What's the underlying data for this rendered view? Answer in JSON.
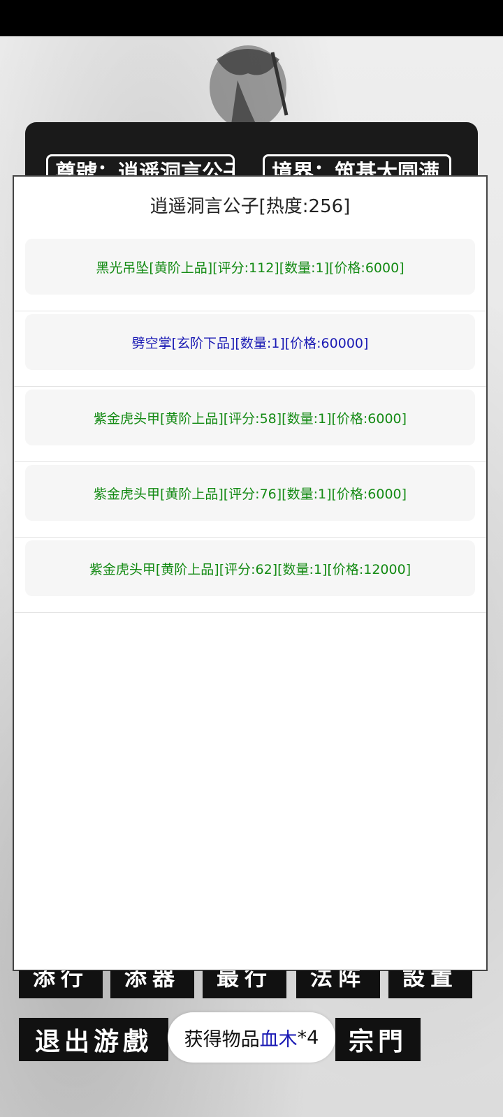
{
  "player_panel": {
    "left_box": "尊號：逍遥洞言公子",
    "right_box": "境界：筑基大圆满"
  },
  "dialog": {
    "title": "逍遥洞言公子[热度:256]",
    "items": [
      {
        "text": "黑光吊坠[黄阶上品][评分:112][数量:1][价格:6000]",
        "color": "#138a13"
      },
      {
        "text": "劈空掌[玄阶下品][数量:1][价格:60000]",
        "color": "#1a1ab4"
      },
      {
        "text": "紫金虎头甲[黄阶上品][评分:58][数量:1][价格:6000]",
        "color": "#138a13"
      },
      {
        "text": "紫金虎头甲[黄阶上品][评分:76][数量:1][价格:6000]",
        "color": "#138a13"
      },
      {
        "text": "紫金虎头甲[黄阶上品][评分:62][数量:1][价格:12000]",
        "color": "#138a13"
      }
    ]
  },
  "menu": {
    "top": [
      "添行",
      "添器",
      "最行",
      "法阵",
      "設置"
    ],
    "exit_game": "退出游戲",
    "sect": "宗門"
  },
  "toast": {
    "prefix": "获得物品",
    "item": "血木",
    "suffix": "*4",
    "item_color": "#1a1ab4"
  }
}
